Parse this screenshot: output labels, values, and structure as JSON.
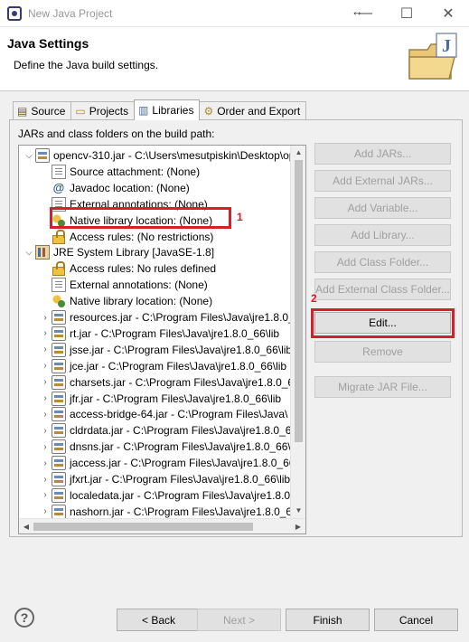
{
  "window": {
    "title": "New Java Project",
    "minimize_icon": "—",
    "maximize_icon": "☐",
    "close_icon": "✕"
  },
  "header": {
    "title": "Java Settings",
    "description": "Define the Java build settings."
  },
  "tabs": [
    {
      "label": "Source"
    },
    {
      "label": "Projects"
    },
    {
      "label": "Libraries"
    },
    {
      "label": "Order and Export"
    }
  ],
  "active_tab": "Libraries",
  "panel": {
    "label": "JARs and class folders on the build path:"
  },
  "tree": [
    {
      "label": "opencv-310.jar - C:\\Users\\mesutpiskin\\Desktop\\op",
      "twisty": "⌵",
      "icon": "jar"
    },
    {
      "label": "Source attachment: (None)",
      "icon": "attr"
    },
    {
      "label": "Javadoc location: (None)",
      "icon": "at"
    },
    {
      "label": "External annotations: (None)",
      "icon": "attr"
    },
    {
      "label": "Native library location: (None)",
      "icon": "native"
    },
    {
      "label": "Access rules: (No restrictions)",
      "icon": "rule"
    },
    {
      "label": "JRE System Library [JavaSE-1.8]",
      "twisty": "⌵",
      "icon": "lib"
    },
    {
      "label": "Access rules: No rules defined",
      "icon": "rule"
    },
    {
      "label": "External annotations: (None)",
      "icon": "attr"
    },
    {
      "label": "Native library location: (None)",
      "icon": "native"
    },
    {
      "label": "resources.jar - C:\\Program Files\\Java\\jre1.8.0_",
      "twisty": "›",
      "icon": "jar"
    },
    {
      "label": "rt.jar - C:\\Program Files\\Java\\jre1.8.0_66\\lib",
      "twisty": "›",
      "icon": "jar"
    },
    {
      "label": "jsse.jar - C:\\Program Files\\Java\\jre1.8.0_66\\lib",
      "twisty": "›",
      "icon": "jar"
    },
    {
      "label": "jce.jar - C:\\Program Files\\Java\\jre1.8.0_66\\lib",
      "twisty": "›",
      "icon": "jar"
    },
    {
      "label": "charsets.jar - C:\\Program Files\\Java\\jre1.8.0_6",
      "twisty": "›",
      "icon": "jar"
    },
    {
      "label": "jfr.jar - C:\\Program Files\\Java\\jre1.8.0_66\\lib",
      "twisty": "›",
      "icon": "jar"
    },
    {
      "label": "access-bridge-64.jar - C:\\Program Files\\Java\\",
      "twisty": "›",
      "icon": "jar"
    },
    {
      "label": "cldrdata.jar - C:\\Program Files\\Java\\jre1.8.0_6",
      "twisty": "›",
      "icon": "jar"
    },
    {
      "label": "dnsns.jar - C:\\Program Files\\Java\\jre1.8.0_66\\",
      "twisty": "›",
      "icon": "jar"
    },
    {
      "label": "jaccess.jar - C:\\Program Files\\Java\\jre1.8.0_66\\",
      "twisty": "›",
      "icon": "jar"
    },
    {
      "label": "jfxrt.jar - C:\\Program Files\\Java\\jre1.8.0_66\\lib",
      "twisty": "›",
      "icon": "jar"
    },
    {
      "label": "localedata.jar - C:\\Program Files\\Java\\jre1.8.0_",
      "twisty": "›",
      "icon": "jar"
    },
    {
      "label": "nashorn.jar - C:\\Program Files\\Java\\jre1.8.0_6",
      "twisty": "›",
      "icon": "jar"
    }
  ],
  "buttons": {
    "add_jars": "Add JARs...",
    "add_external_jars": "Add External JARs...",
    "add_variable": "Add Variable...",
    "add_library": "Add Library...",
    "add_class_folder": "Add Class Folder...",
    "add_external_class_folder": "Add External Class Folder...",
    "edit": "Edit...",
    "remove": "Remove",
    "migrate_jar": "Migrate JAR File..."
  },
  "annotations": {
    "marker_1": "1",
    "marker_2": "2",
    "color": "#d4202a"
  },
  "footer": {
    "help": "?",
    "back": "< Back",
    "next": "Next >",
    "finish": "Finish",
    "cancel": "Cancel"
  }
}
